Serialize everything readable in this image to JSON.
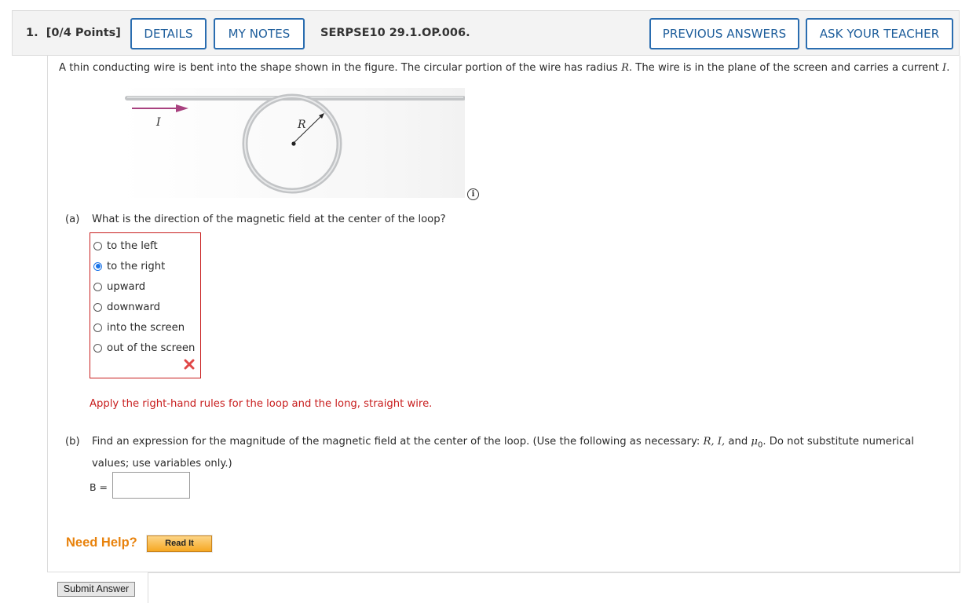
{
  "header": {
    "question_number": "1.",
    "points": "[0/4 Points]",
    "details_label": "DETAILS",
    "my_notes_label": "MY NOTES",
    "question_code": "SERPSE10 29.1.OP.006.",
    "previous_answers_label": "PREVIOUS ANSWERS",
    "ask_teacher_label": "ASK YOUR TEACHER"
  },
  "prompt": {
    "text_before_R": "A thin conducting wire is bent into the shape shown in the figure. The circular portion of the wire has radius ",
    "R": "R",
    "text_middle": ". The wire is in the plane of the screen and carries a current ",
    "I": "I",
    "text_end": "."
  },
  "figure": {
    "current_label": "I",
    "radius_label": "R",
    "arrow_color": "#a8417f"
  },
  "part_a": {
    "label": "(a)",
    "question": "What is the direction of the magnetic field at the center of the loop?",
    "choices": [
      {
        "label": "to the left",
        "selected": false
      },
      {
        "label": "to the right",
        "selected": true
      },
      {
        "label": "upward",
        "selected": false
      },
      {
        "label": "downward",
        "selected": false
      },
      {
        "label": "into the screen",
        "selected": false
      },
      {
        "label": "out of the screen",
        "selected": false
      }
    ],
    "result": "incorrect",
    "hint": "Apply the right-hand rules for the loop and the long, straight wire."
  },
  "part_b": {
    "label": "(b)",
    "line1_before": "Find an expression for the magnitude of the magnetic field at the center of the loop. (Use the following as necessary: ",
    "vars": "R, I,",
    "and": " and ",
    "mu": "μ",
    "sub": "0",
    "line1_after": ". Do not substitute numerical",
    "line2": "values; use variables only.)",
    "input_label": "B =",
    "input_value": ""
  },
  "help": {
    "need_help": "Need Help?",
    "read_it": "Read It"
  },
  "submit_label": "Submit Answer",
  "colors": {
    "accent": "#1d5d9b",
    "error": "#c81e1e",
    "help": "#e8820c"
  }
}
